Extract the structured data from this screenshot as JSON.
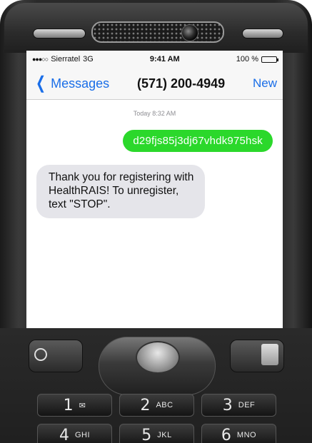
{
  "status_bar": {
    "signal": "●●●○○",
    "carrier": "Sierratel",
    "network": "3G",
    "time": "9:41 AM",
    "battery_percent": "100 %"
  },
  "nav": {
    "back_label": "Messages",
    "contact": "(571) 200-4949",
    "new_label": "New"
  },
  "conversation": {
    "timestamp": "Today 8:32 AM",
    "messages": [
      {
        "direction": "outgoing",
        "text": "d29fjs85j3dj67vhdk975hsk"
      },
      {
        "direction": "incoming",
        "text": "Thank you for registering with HealthRAIS! To unregister, text \"STOP\"."
      }
    ]
  },
  "keypad": {
    "rows": [
      [
        {
          "digit": "1",
          "letters": ""
        },
        {
          "digit": "2",
          "letters": "ABC"
        },
        {
          "digit": "3",
          "letters": "DEF"
        }
      ],
      [
        {
          "digit": "4",
          "letters": "GHI"
        },
        {
          "digit": "5",
          "letters": "JKL"
        },
        {
          "digit": "6",
          "letters": "MNO"
        }
      ]
    ]
  },
  "colors": {
    "ios_blue": "#1a6ee8",
    "outgoing_bubble": "#2bd82b",
    "incoming_bubble": "#e5e5ea"
  },
  "icons": [
    "back-chevron-icon",
    "battery-icon",
    "signal-icon",
    "voicemail-icon",
    "browser-globe-icon",
    "clear-icon"
  ]
}
